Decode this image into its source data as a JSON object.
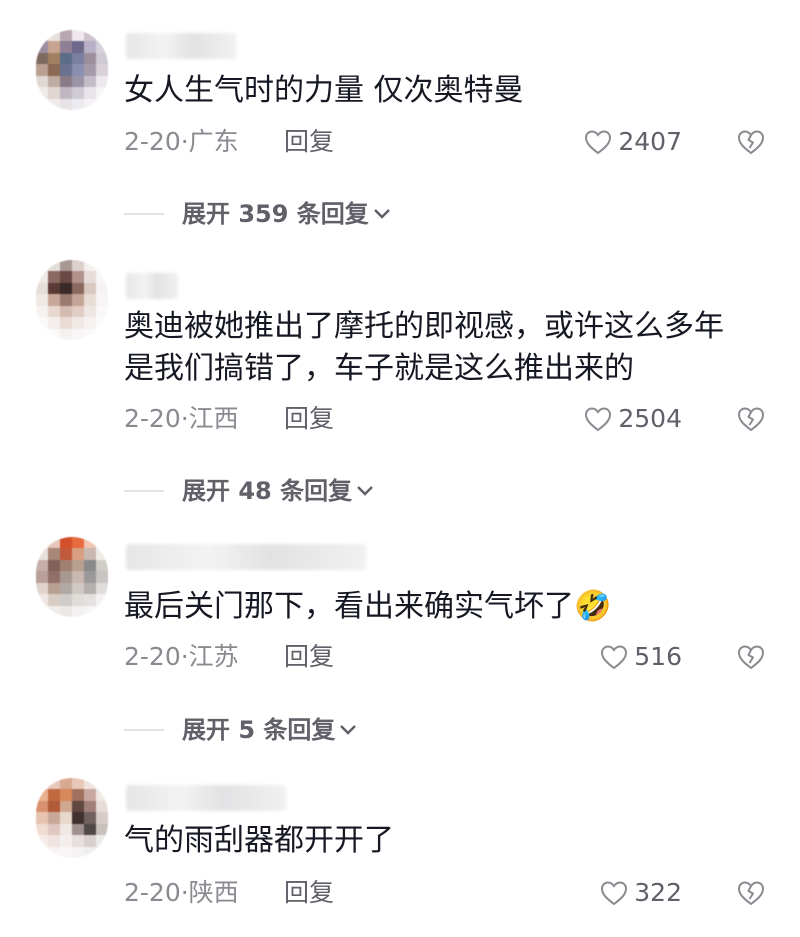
{
  "comments": [
    {
      "text": "女人生气时的力量 仅次奥特曼",
      "date_location": "2-20·广东",
      "reply_label": "回复",
      "likes": "2407",
      "expand_label": "展开 359 条回复"
    },
    {
      "text": "奥迪被她推出了摩托的即视感，或许这么多年\n是我们搞错了，车子就是这么推出来的",
      "date_location": "2-20·江西",
      "reply_label": "回复",
      "likes": "2504",
      "expand_label": "展开 48 条回复"
    },
    {
      "text": "最后关门那下，看出来确实气坏了",
      "emoji": "🤣",
      "date_location": "2-20·江苏",
      "reply_label": "回复",
      "likes": "516",
      "expand_label": "展开 5 条回复"
    },
    {
      "text": "气的雨刮器都开开了",
      "date_location": "2-20·陕西",
      "reply_label": "回复",
      "likes": "322"
    }
  ],
  "icons": {
    "like": "heart-outline-icon",
    "dislike": "broken-heart-icon",
    "expand": "chevron-down-icon"
  },
  "colors": {
    "text": "#161823",
    "meta": "#8a8b91",
    "secondary": "#5f6068",
    "icon": "#8a8b91"
  }
}
